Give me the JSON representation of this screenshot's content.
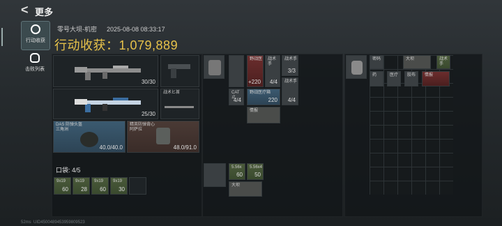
{
  "header": {
    "back_glyph": "<",
    "title": "更多"
  },
  "tabs": [
    {
      "label": "行动收获",
      "active": true,
      "icon": "target-icon"
    },
    {
      "label": "击败列表",
      "active": false,
      "icon": "skull-icon"
    }
  ],
  "raid": {
    "map": "零号大坝-机密",
    "datetime": "2025-08-08 08:33:17",
    "total_label": "行动收获：",
    "total_value": "1,079,889"
  },
  "loadout": {
    "primary_ammo": "30/30",
    "secondary_ammo": "25/30",
    "melee_label": "战术匕首",
    "helmet": {
      "name": "DAS 防弹头盔",
      "sub": "三角洲",
      "durability": "40.0/40.0"
    },
    "armor": {
      "name": "精英防弹背心",
      "sub": "阿萨拉",
      "durability": "48.0/91.0"
    }
  },
  "pocket": {
    "label": "口袋: 4/5",
    "ammo": [
      {
        "name": "9x19",
        "count": "60"
      },
      {
        "name": "9x19",
        "count": "28"
      },
      {
        "name": "9x19",
        "count": "60"
      },
      {
        "name": "9x19",
        "count": "30"
      }
    ]
  },
  "rig": {
    "items": [
      {
        "name": "野战医",
        "count": "+220"
      },
      {
        "name": "战术手",
        "count": "4/4"
      },
      {
        "name": "战术手",
        "count": "3/3"
      },
      {
        "name": "CAT止",
        "count": "4/4"
      },
      {
        "name": "野战医疗箱",
        "count": "220"
      },
      {
        "name": "战术手",
        "count": "4/4"
      },
      {
        "name": "情报",
        "count": ""
      }
    ]
  },
  "pouch": {
    "items": [
      {
        "name": "5.56x",
        "count": "60"
      },
      {
        "name": "5.56x4",
        "count": "50"
      },
      {
        "name": "大坝",
        "count": ""
      }
    ]
  },
  "backpack": {
    "items": [
      {
        "name": "密码"
      },
      {
        "name": "大坝"
      },
      {
        "name": "战术手"
      },
      {
        "name": "药"
      },
      {
        "name": "医疗"
      },
      {
        "name": "胶布"
      },
      {
        "name": "情报"
      }
    ]
  },
  "status": {
    "net": "52ms",
    "uid": "UID4500489453959809523"
  }
}
